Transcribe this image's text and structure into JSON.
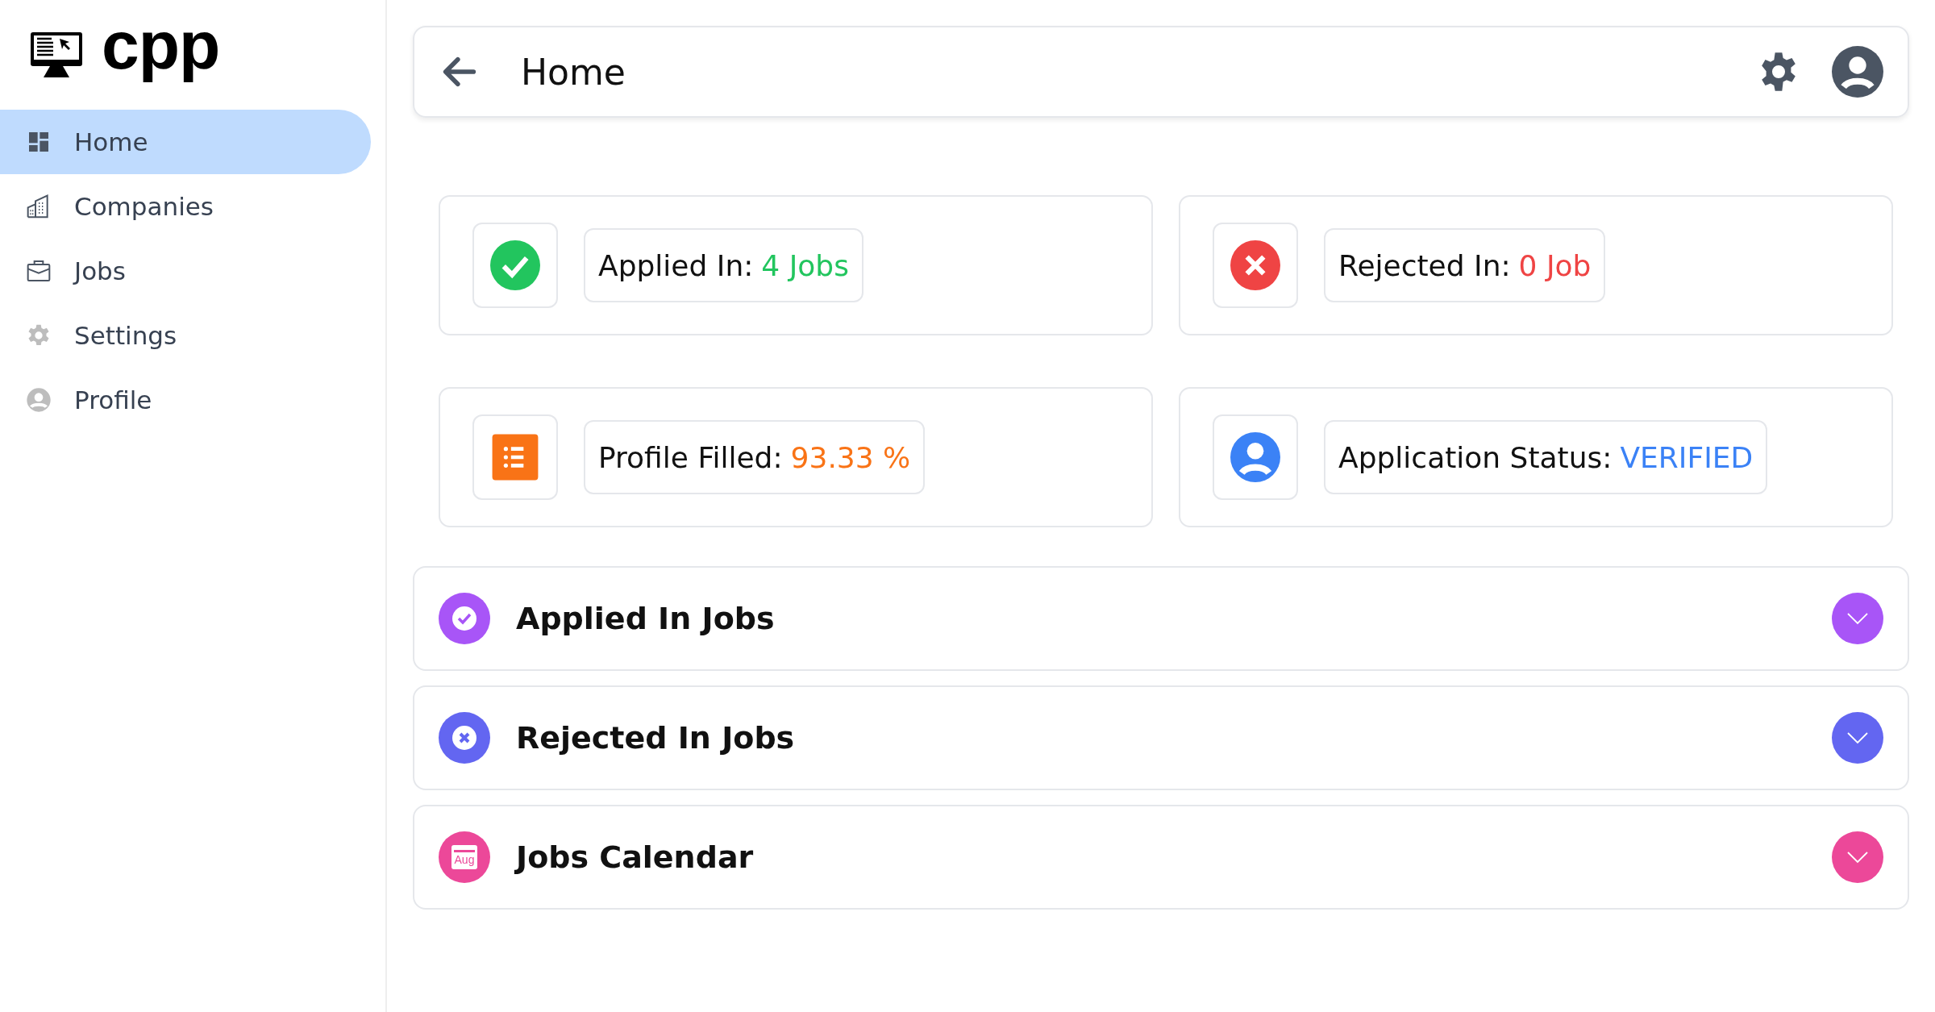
{
  "logo": {
    "text": "cpp"
  },
  "sidebar": {
    "items": [
      {
        "kind": "dashboard",
        "label": "Home",
        "selected": true
      },
      {
        "kind": "building",
        "label": "Companies",
        "selected": false
      },
      {
        "kind": "briefcase",
        "label": "Jobs",
        "selected": false
      },
      {
        "kind": "gear",
        "label": "Settings",
        "selected": false
      },
      {
        "kind": "person",
        "label": "Profile",
        "selected": false
      }
    ]
  },
  "header": {
    "title": "Home"
  },
  "stats": [
    {
      "kind": "check",
      "label": "Applied In:",
      "value": "4 Jobs",
      "color": "#22c55e"
    },
    {
      "kind": "cross",
      "label": "Rejected In:",
      "value": "0 Job",
      "color": "#ef4444"
    },
    {
      "kind": "list",
      "label": "Profile Filled:",
      "value": "93.33 %",
      "color": "#f97316"
    },
    {
      "kind": "person",
      "label": "Application Status:",
      "value": "VERIFIED",
      "color": "#3b82f6"
    }
  ],
  "accordions": [
    {
      "kind": "check",
      "title": "Applied In Jobs",
      "color": "#a855f7",
      "expanded": false
    },
    {
      "kind": "cross",
      "title": "Rejected In Jobs",
      "color": "#6366f1",
      "expanded": false
    },
    {
      "kind": "calendar",
      "title": "Jobs Calendar",
      "color": "#ec4899",
      "expanded": false,
      "icon_text": "Aug"
    }
  ]
}
